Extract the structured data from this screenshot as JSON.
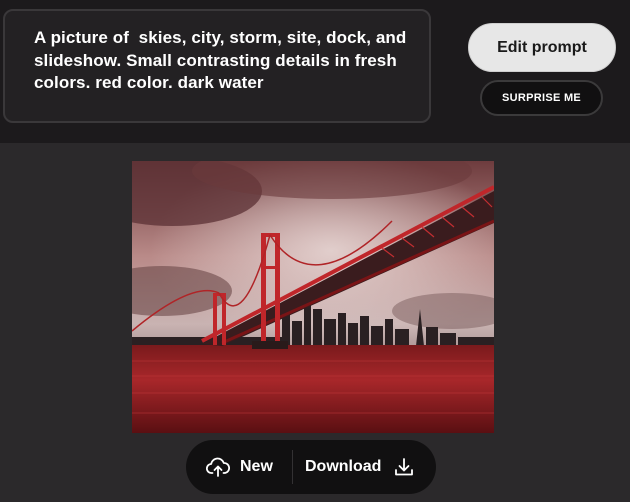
{
  "prompt": {
    "text": "A picture of  skies, city, storm, site, dock, and slideshow. Small contrasting details in fresh colors. red color. dark water"
  },
  "buttons": {
    "edit_prompt": "Edit prompt",
    "surprise_me": "SURPRISE ME",
    "new": "New",
    "download": "Download"
  },
  "icons": {
    "new": "cloud-upload-icon",
    "download": "download-icon"
  },
  "colors": {
    "background": "#2b292b",
    "top_band": "#1c1a1c",
    "accent_red": "#c0262a"
  }
}
